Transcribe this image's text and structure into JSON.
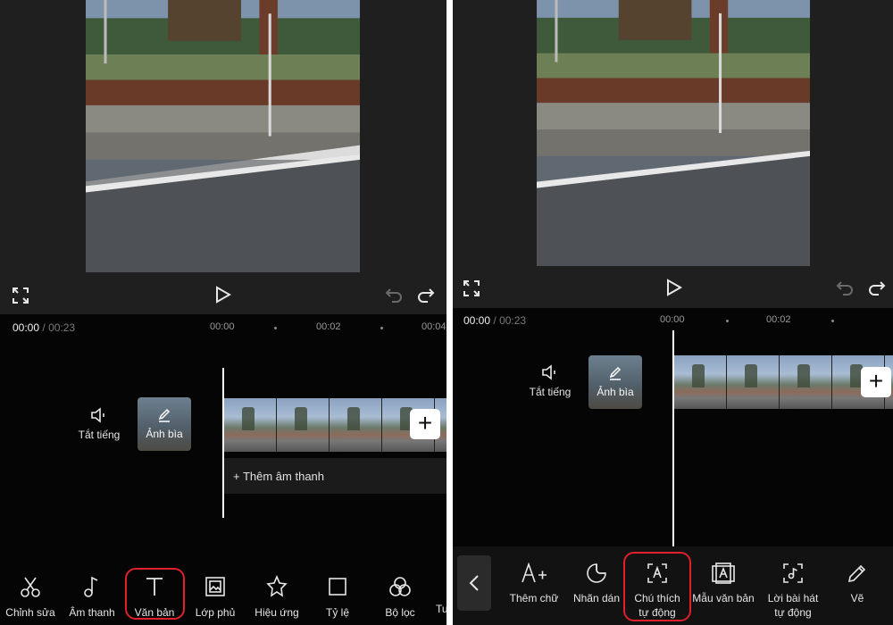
{
  "left": {
    "time": {
      "current": "00:00",
      "separator": "/",
      "total": "00:23"
    },
    "ticks": [
      "00:00",
      "00:02",
      "00:04"
    ],
    "mute_label": "Tắt tiếng",
    "cover_label": "Ảnh bìa",
    "add_audio_label": "+ Thêm âm thanh",
    "add_clip_label": "+",
    "tools": [
      {
        "label": "Chỉnh sửa",
        "icon": "scissors-icon"
      },
      {
        "label": "Âm thanh",
        "icon": "music-note-icon"
      },
      {
        "label": "Văn bản",
        "icon": "text-icon"
      },
      {
        "label": "Lớp phủ",
        "icon": "overlay-icon"
      },
      {
        "label": "Hiệu ứng",
        "icon": "effects-star-icon"
      },
      {
        "label": "Tỷ lệ",
        "icon": "ratio-square-icon"
      },
      {
        "label": "Bộ lọc",
        "icon": "filter-icon"
      },
      {
        "label": "Tu",
        "icon": ""
      }
    ],
    "highlighted_tool": "Văn bản"
  },
  "right": {
    "time": {
      "current": "00:00",
      "separator": "/",
      "total": "00:23"
    },
    "ticks": [
      "00:00",
      "00:02"
    ],
    "mute_label": "Tắt tiếng",
    "cover_label": "Ảnh bìa",
    "add_clip_label": "+",
    "tools": [
      {
        "label": "Thêm chữ",
        "icon": "add-text-icon"
      },
      {
        "label": "Nhãn dán",
        "icon": "sticker-icon"
      },
      {
        "label": "Chú thích tự động",
        "line1": "Chú thích",
        "line2": "tự động",
        "icon": "auto-caption-icon"
      },
      {
        "label": "Mẫu văn bản",
        "icon": "text-template-icon"
      },
      {
        "label": "Lời bài hát tự động",
        "line1": "Lời bài hát",
        "line2": "tự động",
        "icon": "auto-lyrics-icon"
      },
      {
        "label": "Vẽ",
        "icon": "pencil-icon"
      }
    ],
    "highlighted_tool": "Chú thích tự động"
  },
  "colors": {
    "highlight": "#e0202a",
    "panel_bg": "#050505",
    "preview_bg": "#1f1f1f"
  }
}
